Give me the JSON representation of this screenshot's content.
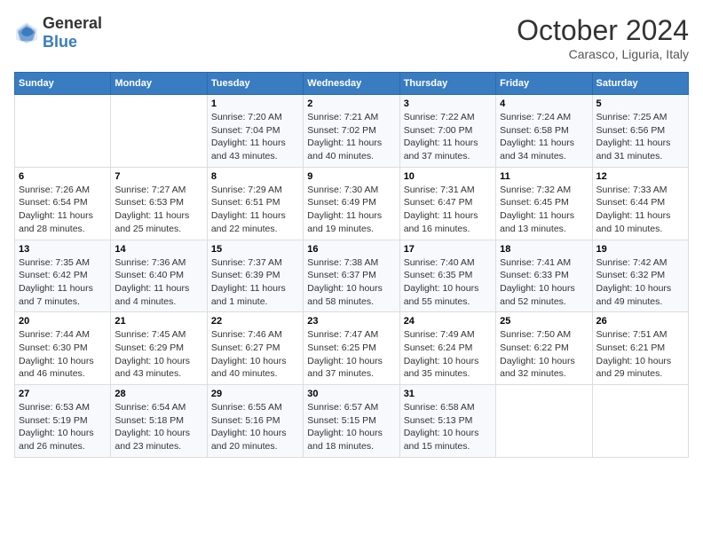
{
  "header": {
    "logo_general": "General",
    "logo_blue": "Blue",
    "month_title": "October 2024",
    "location": "Carasco, Liguria, Italy"
  },
  "days_of_week": [
    "Sunday",
    "Monday",
    "Tuesday",
    "Wednesday",
    "Thursday",
    "Friday",
    "Saturday"
  ],
  "weeks": [
    [
      {
        "day": "",
        "content": ""
      },
      {
        "day": "",
        "content": ""
      },
      {
        "day": "1",
        "content": "Sunrise: 7:20 AM\nSunset: 7:04 PM\nDaylight: 11 hours and 43 minutes."
      },
      {
        "day": "2",
        "content": "Sunrise: 7:21 AM\nSunset: 7:02 PM\nDaylight: 11 hours and 40 minutes."
      },
      {
        "day": "3",
        "content": "Sunrise: 7:22 AM\nSunset: 7:00 PM\nDaylight: 11 hours and 37 minutes."
      },
      {
        "day": "4",
        "content": "Sunrise: 7:24 AM\nSunset: 6:58 PM\nDaylight: 11 hours and 34 minutes."
      },
      {
        "day": "5",
        "content": "Sunrise: 7:25 AM\nSunset: 6:56 PM\nDaylight: 11 hours and 31 minutes."
      }
    ],
    [
      {
        "day": "6",
        "content": "Sunrise: 7:26 AM\nSunset: 6:54 PM\nDaylight: 11 hours and 28 minutes."
      },
      {
        "day": "7",
        "content": "Sunrise: 7:27 AM\nSunset: 6:53 PM\nDaylight: 11 hours and 25 minutes."
      },
      {
        "day": "8",
        "content": "Sunrise: 7:29 AM\nSunset: 6:51 PM\nDaylight: 11 hours and 22 minutes."
      },
      {
        "day": "9",
        "content": "Sunrise: 7:30 AM\nSunset: 6:49 PM\nDaylight: 11 hours and 19 minutes."
      },
      {
        "day": "10",
        "content": "Sunrise: 7:31 AM\nSunset: 6:47 PM\nDaylight: 11 hours and 16 minutes."
      },
      {
        "day": "11",
        "content": "Sunrise: 7:32 AM\nSunset: 6:45 PM\nDaylight: 11 hours and 13 minutes."
      },
      {
        "day": "12",
        "content": "Sunrise: 7:33 AM\nSunset: 6:44 PM\nDaylight: 11 hours and 10 minutes."
      }
    ],
    [
      {
        "day": "13",
        "content": "Sunrise: 7:35 AM\nSunset: 6:42 PM\nDaylight: 11 hours and 7 minutes."
      },
      {
        "day": "14",
        "content": "Sunrise: 7:36 AM\nSunset: 6:40 PM\nDaylight: 11 hours and 4 minutes."
      },
      {
        "day": "15",
        "content": "Sunrise: 7:37 AM\nSunset: 6:39 PM\nDaylight: 11 hours and 1 minute."
      },
      {
        "day": "16",
        "content": "Sunrise: 7:38 AM\nSunset: 6:37 PM\nDaylight: 10 hours and 58 minutes."
      },
      {
        "day": "17",
        "content": "Sunrise: 7:40 AM\nSunset: 6:35 PM\nDaylight: 10 hours and 55 minutes."
      },
      {
        "day": "18",
        "content": "Sunrise: 7:41 AM\nSunset: 6:33 PM\nDaylight: 10 hours and 52 minutes."
      },
      {
        "day": "19",
        "content": "Sunrise: 7:42 AM\nSunset: 6:32 PM\nDaylight: 10 hours and 49 minutes."
      }
    ],
    [
      {
        "day": "20",
        "content": "Sunrise: 7:44 AM\nSunset: 6:30 PM\nDaylight: 10 hours and 46 minutes."
      },
      {
        "day": "21",
        "content": "Sunrise: 7:45 AM\nSunset: 6:29 PM\nDaylight: 10 hours and 43 minutes."
      },
      {
        "day": "22",
        "content": "Sunrise: 7:46 AM\nSunset: 6:27 PM\nDaylight: 10 hours and 40 minutes."
      },
      {
        "day": "23",
        "content": "Sunrise: 7:47 AM\nSunset: 6:25 PM\nDaylight: 10 hours and 37 minutes."
      },
      {
        "day": "24",
        "content": "Sunrise: 7:49 AM\nSunset: 6:24 PM\nDaylight: 10 hours and 35 minutes."
      },
      {
        "day": "25",
        "content": "Sunrise: 7:50 AM\nSunset: 6:22 PM\nDaylight: 10 hours and 32 minutes."
      },
      {
        "day": "26",
        "content": "Sunrise: 7:51 AM\nSunset: 6:21 PM\nDaylight: 10 hours and 29 minutes."
      }
    ],
    [
      {
        "day": "27",
        "content": "Sunrise: 6:53 AM\nSunset: 5:19 PM\nDaylight: 10 hours and 26 minutes."
      },
      {
        "day": "28",
        "content": "Sunrise: 6:54 AM\nSunset: 5:18 PM\nDaylight: 10 hours and 23 minutes."
      },
      {
        "day": "29",
        "content": "Sunrise: 6:55 AM\nSunset: 5:16 PM\nDaylight: 10 hours and 20 minutes."
      },
      {
        "day": "30",
        "content": "Sunrise: 6:57 AM\nSunset: 5:15 PM\nDaylight: 10 hours and 18 minutes."
      },
      {
        "day": "31",
        "content": "Sunrise: 6:58 AM\nSunset: 5:13 PM\nDaylight: 10 hours and 15 minutes."
      },
      {
        "day": "",
        "content": ""
      },
      {
        "day": "",
        "content": ""
      }
    ]
  ]
}
